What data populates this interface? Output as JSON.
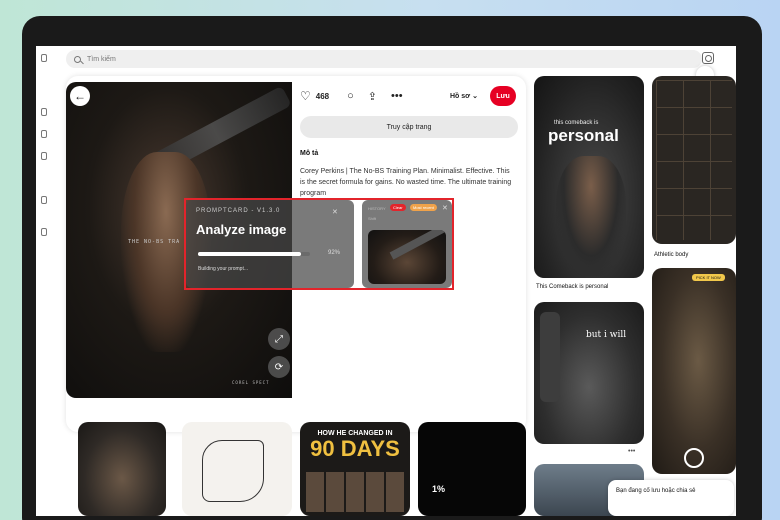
{
  "search": {
    "placeholder": "Tìm kiếm"
  },
  "pin": {
    "image_text_1": "THE NO-BS TRA",
    "image_text_2": "COREL SPECT",
    "likes": "468",
    "board_select": "Hồ sơ",
    "save_label": "Lưu",
    "visit_label": "Truy cập trang",
    "description_title": "Mô tả",
    "description_text": "Corey Perkins | The No-BS Training Plan. Minimalist. Effective. This is the secret formula for gains. No wasted time. The ultimate training program"
  },
  "prompt_card": {
    "version": "PROMPTCARD - V1.3.0",
    "title": "Analyze image",
    "progress_percent": 92,
    "progress_label": "92%",
    "status": "Building your prompt...",
    "history_label": "HISTORY",
    "badge_1": "Clear",
    "badge_2": "Most recent",
    "sub_label": "Shift"
  },
  "feed": {
    "card_1_small": "this comeback is",
    "card_1_big": "personal",
    "card_1_caption": "This Comeback is personal",
    "card_2_caption": "Athletic body",
    "card_3_text": "but i will",
    "card_4_tag": "PICK IT NOW",
    "card_6_text": "Bạn đang cố lưu hoặc chia sẻ",
    "bottom_3_line1": "HOW HE CHANGED IN",
    "bottom_3_line2": "90 DAYS",
    "bottom_4_text": "1%"
  },
  "colors": {
    "accent": "#e60023",
    "highlight": "#e3242b",
    "badge_secondary": "#f0a24a"
  }
}
